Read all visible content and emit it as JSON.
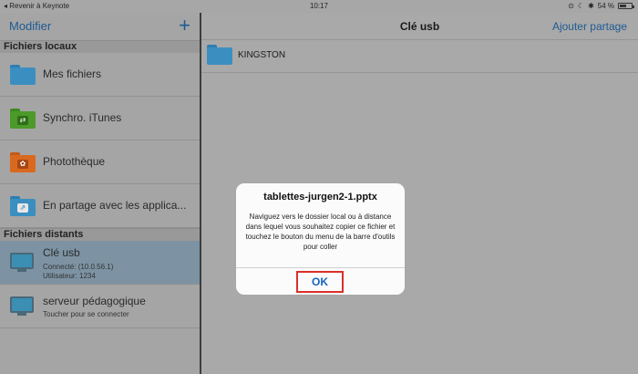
{
  "status_bar": {
    "back_text": "◂ Revenir à Keynote",
    "time": "10:17",
    "battery_text": "54 %"
  },
  "sidebar": {
    "edit_label": "Modifier",
    "add_label": "+",
    "local_section": "Fichiers locaux",
    "local_items": [
      {
        "label": "Mes fichiers",
        "icon": "folder-icon"
      },
      {
        "label": "Synchro. iTunes",
        "icon": "sync-folder-icon"
      },
      {
        "label": "Photothèque",
        "icon": "photo-folder-icon"
      },
      {
        "label": "En partage avec les applica...",
        "icon": "shared-folder-icon"
      }
    ],
    "remote_section": "Fichiers distants",
    "remote_items": [
      {
        "label": "Clé usb",
        "sub1": "Connecté: (10.0.56.1)",
        "sub2": "Utilisateur: 1234",
        "selected": true,
        "icon": "monitor-icon"
      },
      {
        "label": "serveur pédagogique",
        "sub1": "Toucher pour se connecter",
        "selected": false,
        "icon": "monitor-icon"
      }
    ]
  },
  "main": {
    "title": "Clé usb",
    "share_label": "Ajouter partage",
    "items": [
      {
        "label": "KINGSTON",
        "icon": "folder-icon"
      }
    ]
  },
  "dialog": {
    "title": "tablettes-jurgen2-1.pptx",
    "message": "Naviguez vers le dossier local ou à distance dans lequel vous souhaitez copier ce fichier et touchez le bouton du menu de la barre d'outils pour coller",
    "ok_label": "OK"
  },
  "colors": {
    "accent": "#1e5a93",
    "folder_blue": "#3a8fc0",
    "sync_green": "#4c9a2a",
    "photo_orange": "#d9691e",
    "ok_highlight": "#d9302a"
  }
}
